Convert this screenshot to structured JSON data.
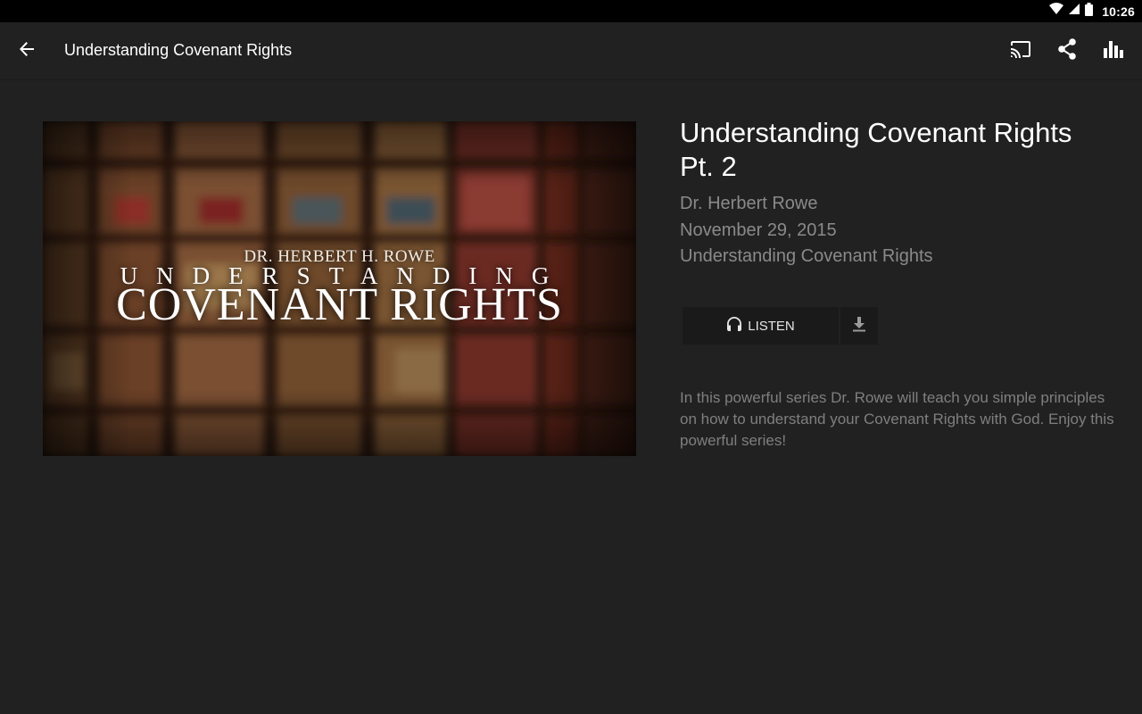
{
  "status_bar": {
    "time": "10:26",
    "icons": [
      "wifi-icon",
      "cell-signal-icon",
      "battery-icon"
    ]
  },
  "app_bar": {
    "title": "Understanding Covenant Rights",
    "actions": [
      "cast-icon",
      "share-icon",
      "equalizer-icon"
    ]
  },
  "cover": {
    "author": "DR. HERBERT H. ROWE",
    "line1": "UNDERSTANDING",
    "line2": "COVENANT RIGHTS"
  },
  "episode": {
    "title": "Understanding Covenant Rights Pt. 2",
    "speaker": "Dr. Herbert Rowe",
    "date": "November 29, 2015",
    "series": "Understanding Covenant Rights",
    "listen_label": "LISTEN",
    "description": "In this powerful series Dr. Rowe will teach you simple principles on how to understand your Covenant Rights with God. Enjoy this powerful series!"
  },
  "colors": {
    "background": "#212121",
    "status_bar": "#000000",
    "title_text": "#ffffff",
    "meta_text": "#8a8a8a",
    "button_bg": "#1a1a1a"
  }
}
